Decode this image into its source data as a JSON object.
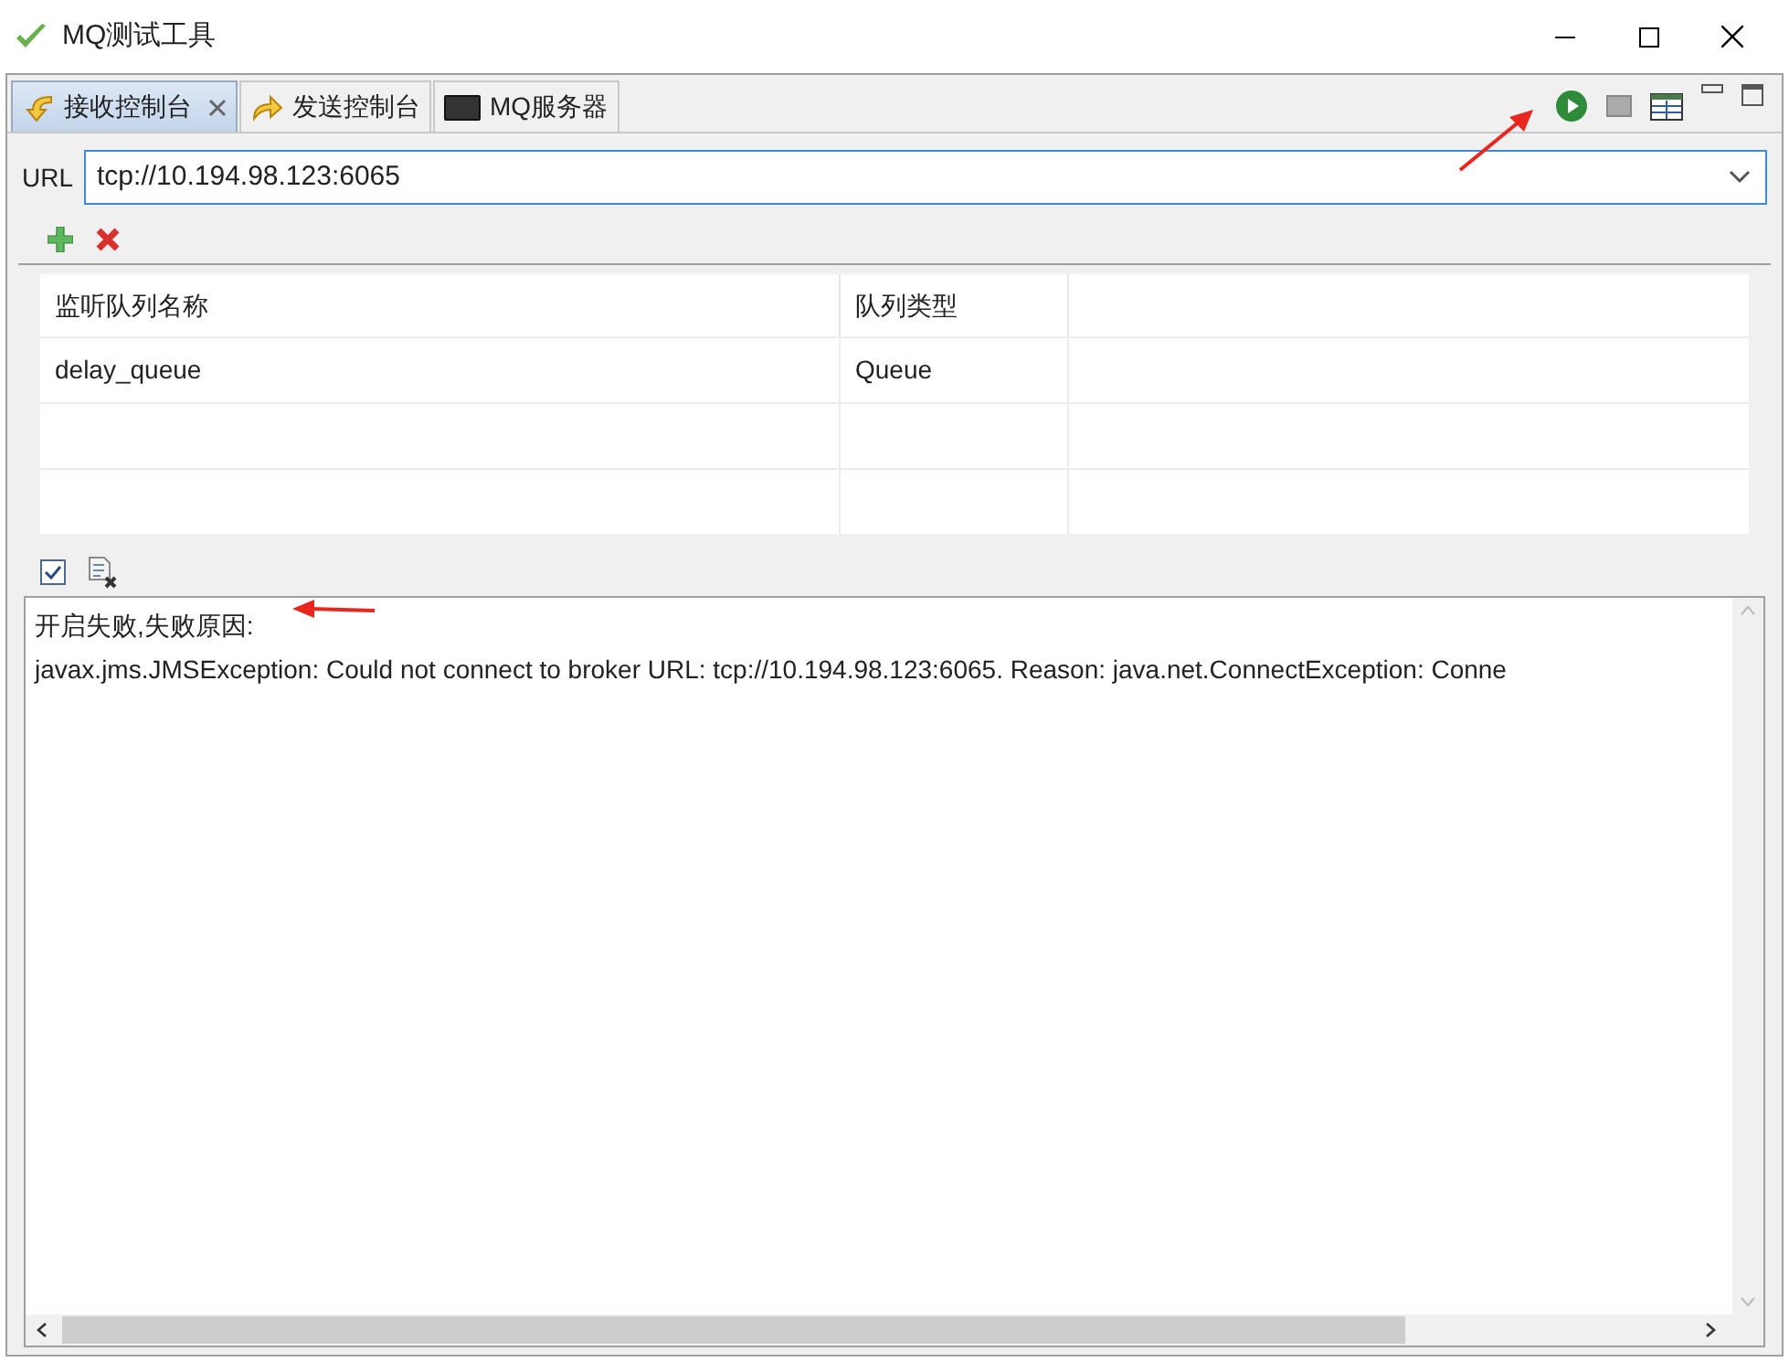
{
  "window": {
    "title": "MQ测试工具"
  },
  "tabs": [
    {
      "label": "接收控制台",
      "selected": true,
      "closable": true,
      "kind": "receive"
    },
    {
      "label": "发送控制台",
      "selected": false,
      "closable": false,
      "kind": "send"
    },
    {
      "label": "MQ服务器",
      "selected": false,
      "closable": false,
      "kind": "server"
    }
  ],
  "url": {
    "label": "URL",
    "value": "tcp://10.194.98.123:6065"
  },
  "table": {
    "columns": [
      "监听队列名称",
      "队列类型"
    ],
    "rows": [
      [
        "delay_queue",
        "Queue"
      ]
    ]
  },
  "log": {
    "lines": [
      "开启失败,失败原因:",
      "javax.jms.JMSException: Could not connect to broker URL: tcp://10.194.98.123:6065. Reason: java.net.ConnectException: Conne"
    ]
  }
}
